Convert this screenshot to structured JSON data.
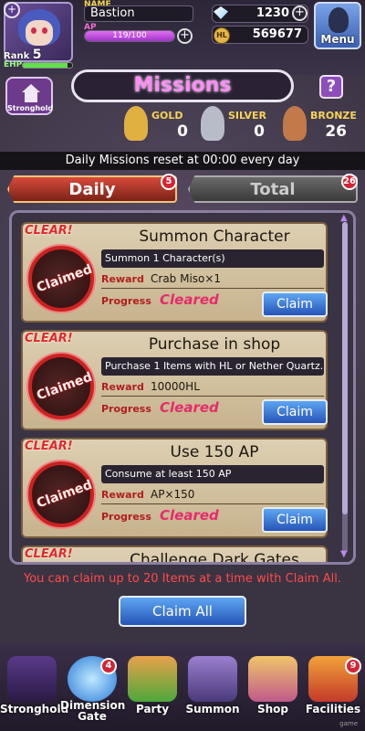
{
  "player": {
    "name_label": "NAME",
    "name": "Bastion",
    "ap_label": "AP",
    "ap_text": "119/100",
    "ap_fraction": 1.0,
    "rank_label": "Rank",
    "rank_value": "5",
    "ehp_label": "EHP",
    "ehp_fraction": 0.9
  },
  "currency": {
    "gems": "1230",
    "hl_icon_text": "HL",
    "hl": "569677"
  },
  "menu_label": "Menu",
  "stronghold_label": "Stronghold",
  "title": "Missions",
  "help_label": "?",
  "medals": [
    {
      "label": "GOLD",
      "value": "0",
      "color": "#e0b040"
    },
    {
      "label": "SILVER",
      "value": "0",
      "color": "#b8bcc8"
    },
    {
      "label": "BRONZE",
      "value": "26",
      "color": "#c27a4a"
    }
  ],
  "reset_text": "Daily Missions reset at 00:00 every day",
  "tabs": [
    {
      "label": "Daily",
      "badge": "5"
    },
    {
      "label": "Total",
      "badge": "26"
    }
  ],
  "clear_text": "CLEAR!",
  "stamp_text": "Claimed",
  "reward_label": "Reward",
  "progress_label": "Progress",
  "missions": [
    {
      "title": "Summon Character",
      "desc": "Summon 1 Character(s)",
      "reward": "Crab Miso×1",
      "progress": "Cleared",
      "claim": "Claim"
    },
    {
      "title": "Purchase in shop",
      "desc": "Purchase 1 Items with HL or Nether Quartz.",
      "reward": "10000HL",
      "progress": "Cleared",
      "claim": "Claim"
    },
    {
      "title": "Use 150 AP",
      "desc": "Consume at least 150 AP",
      "reward": "AP×150",
      "progress": "Cleared",
      "claim": "Claim"
    },
    {
      "title": "Challenge Dark Gates"
    }
  ],
  "claim_all_note": "You can claim up to 20 Items at a time with Claim All.",
  "claim_all_label": "Claim All",
  "nav": [
    {
      "label": "Stronghold",
      "badge": ""
    },
    {
      "label": "Dimension Gate",
      "badge": "4"
    },
    {
      "label": "Party",
      "badge": ""
    },
    {
      "label": "Summon",
      "badge": ""
    },
    {
      "label": "Shop",
      "badge": ""
    },
    {
      "label": "Facilities",
      "badge": "9"
    }
  ],
  "credit": "game"
}
